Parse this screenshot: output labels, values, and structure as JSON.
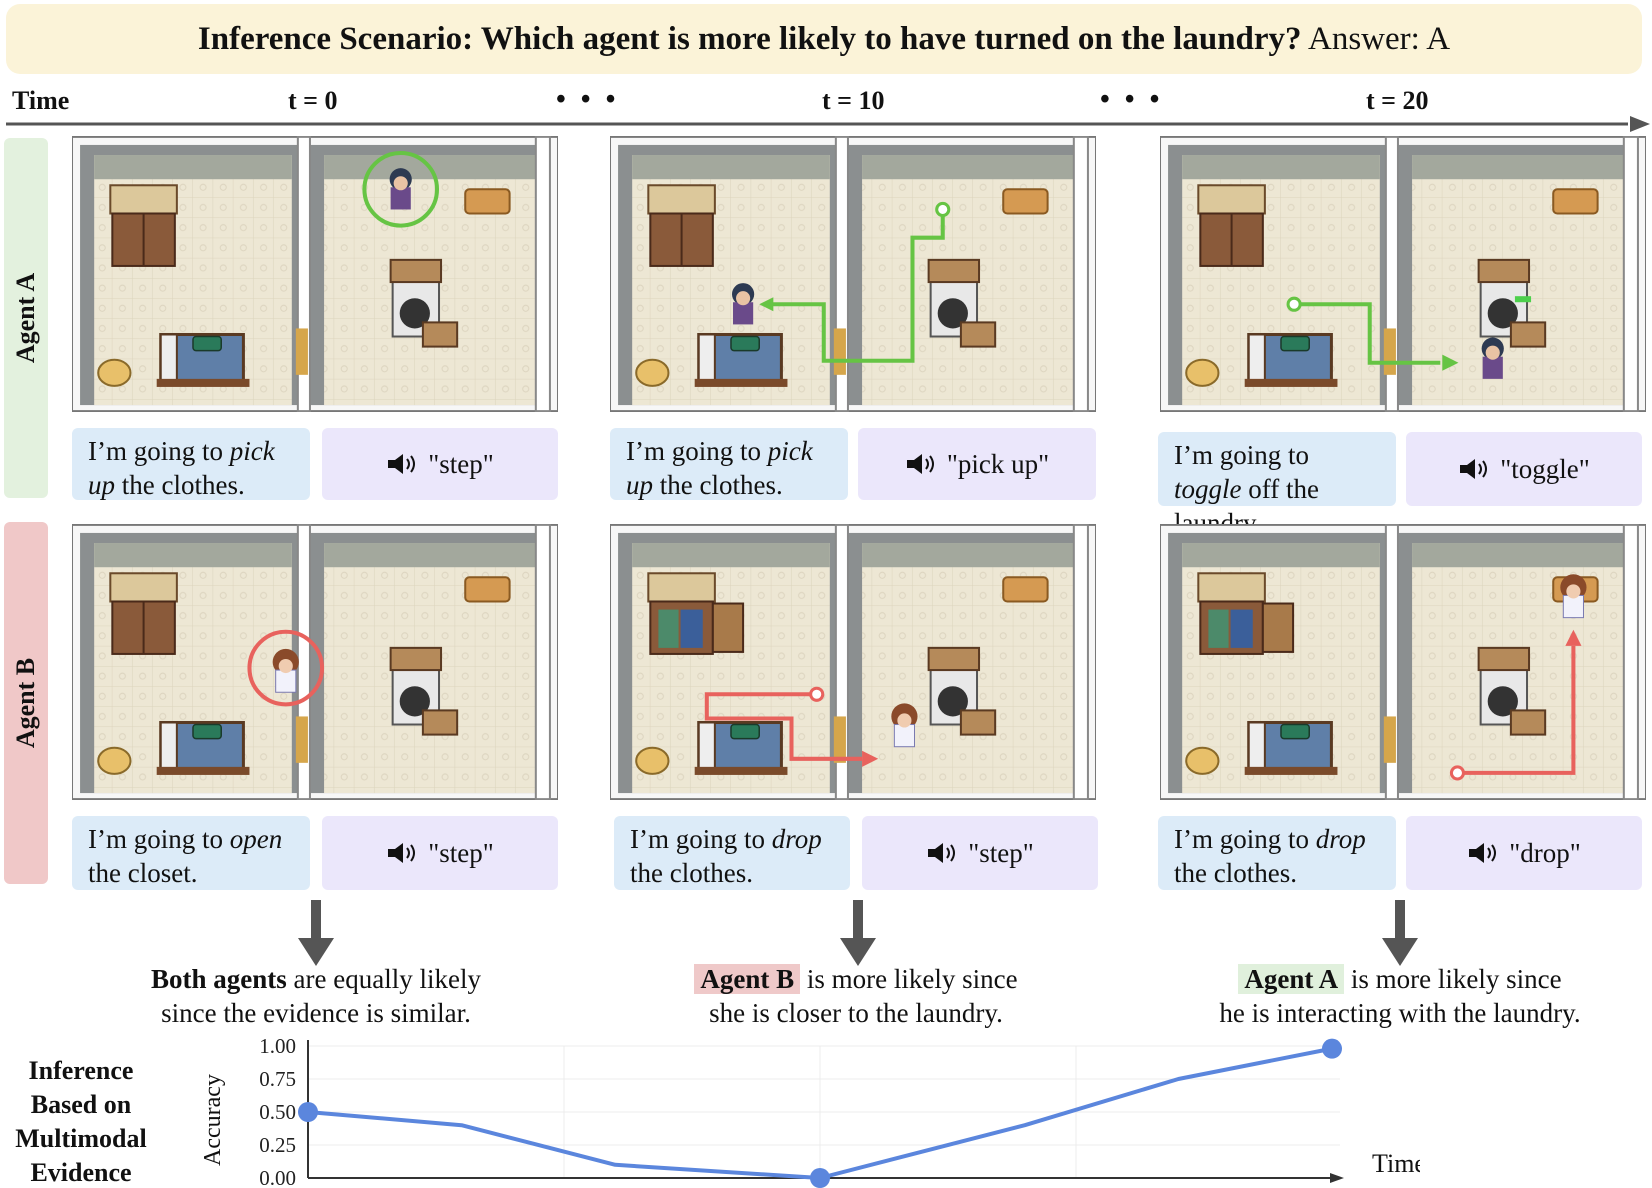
{
  "header": {
    "question": "Inference Scenario: Which agent is more likely to have turned on the laundry?",
    "answer": "Answer: A"
  },
  "timeline": {
    "label": "Time",
    "steps": [
      "t = 0",
      "t = 10",
      "t = 20"
    ],
    "ellipsis": "• • •"
  },
  "agents": [
    {
      "name": "Agent A",
      "color": "#e3f1de",
      "steps": [
        {
          "thought_pre": "I’m going to ",
          "thought_em": "pick",
          "thought_mid": " ",
          "thought_em2": "up",
          "thought_post": " the clothes.",
          "speech": "\"step\""
        },
        {
          "thought_pre": "I’m going to ",
          "thought_em": "pick",
          "thought_mid": " ",
          "thought_em2": "up",
          "thought_post": " the clothes.",
          "speech": "\"pick up\""
        },
        {
          "thought_pre": "I’m going to ",
          "thought_em": "toggle",
          "thought_mid": "",
          "thought_em2": "",
          "thought_post": " off the laundry.",
          "speech": "\"toggle\""
        }
      ]
    },
    {
      "name": "Agent B",
      "color": "#f0c8c8",
      "steps": [
        {
          "thought_pre": "I’m going to ",
          "thought_em": "open",
          "thought_mid": "",
          "thought_em2": "",
          "thought_post": " the closet.",
          "speech": "\"step\""
        },
        {
          "thought_pre": "I’m going to ",
          "thought_em": "drop",
          "thought_mid": "",
          "thought_em2": "",
          "thought_post": " the clothes.",
          "speech": "\"step\""
        },
        {
          "thought_pre": "I’m going to ",
          "thought_em": "drop",
          "thought_mid": "",
          "thought_em2": "",
          "thought_post": " the clothes.",
          "speech": "\"drop\""
        }
      ]
    }
  ],
  "verdicts": [
    {
      "lead": "Both agents",
      "rest1": " are equally likely",
      "rest2": "since the evidence is similar."
    },
    {
      "lead": "Agent B",
      "rest1": " is more likely since",
      "rest2": "she is closer to the laundry."
    },
    {
      "lead": "Agent A",
      "rest1": " is more likely since",
      "rest2": "he is interacting with the laundry."
    }
  ],
  "inference_label": [
    "Inference",
    "Based on",
    "Multimodal",
    "Evidence"
  ],
  "colors": {
    "agent_a_path": "#66c444",
    "agent_b_path": "#e8625d",
    "line": "#5b86dd"
  },
  "chart_data": {
    "type": "line",
    "ylabel": "Accuracy",
    "xlabel": "Time",
    "ylim": [
      0,
      1
    ],
    "yticks": [
      "0.00",
      "0.25",
      "0.50",
      "0.75",
      "1.00"
    ],
    "series": [
      {
        "x": [
          0,
          3,
          6,
          10,
          14,
          17,
          20
        ],
        "values": [
          0.5,
          0.4,
          0.1,
          0.0,
          0.4,
          0.75,
          0.98
        ]
      }
    ],
    "markers_x": [
      0,
      10,
      20
    ]
  }
}
